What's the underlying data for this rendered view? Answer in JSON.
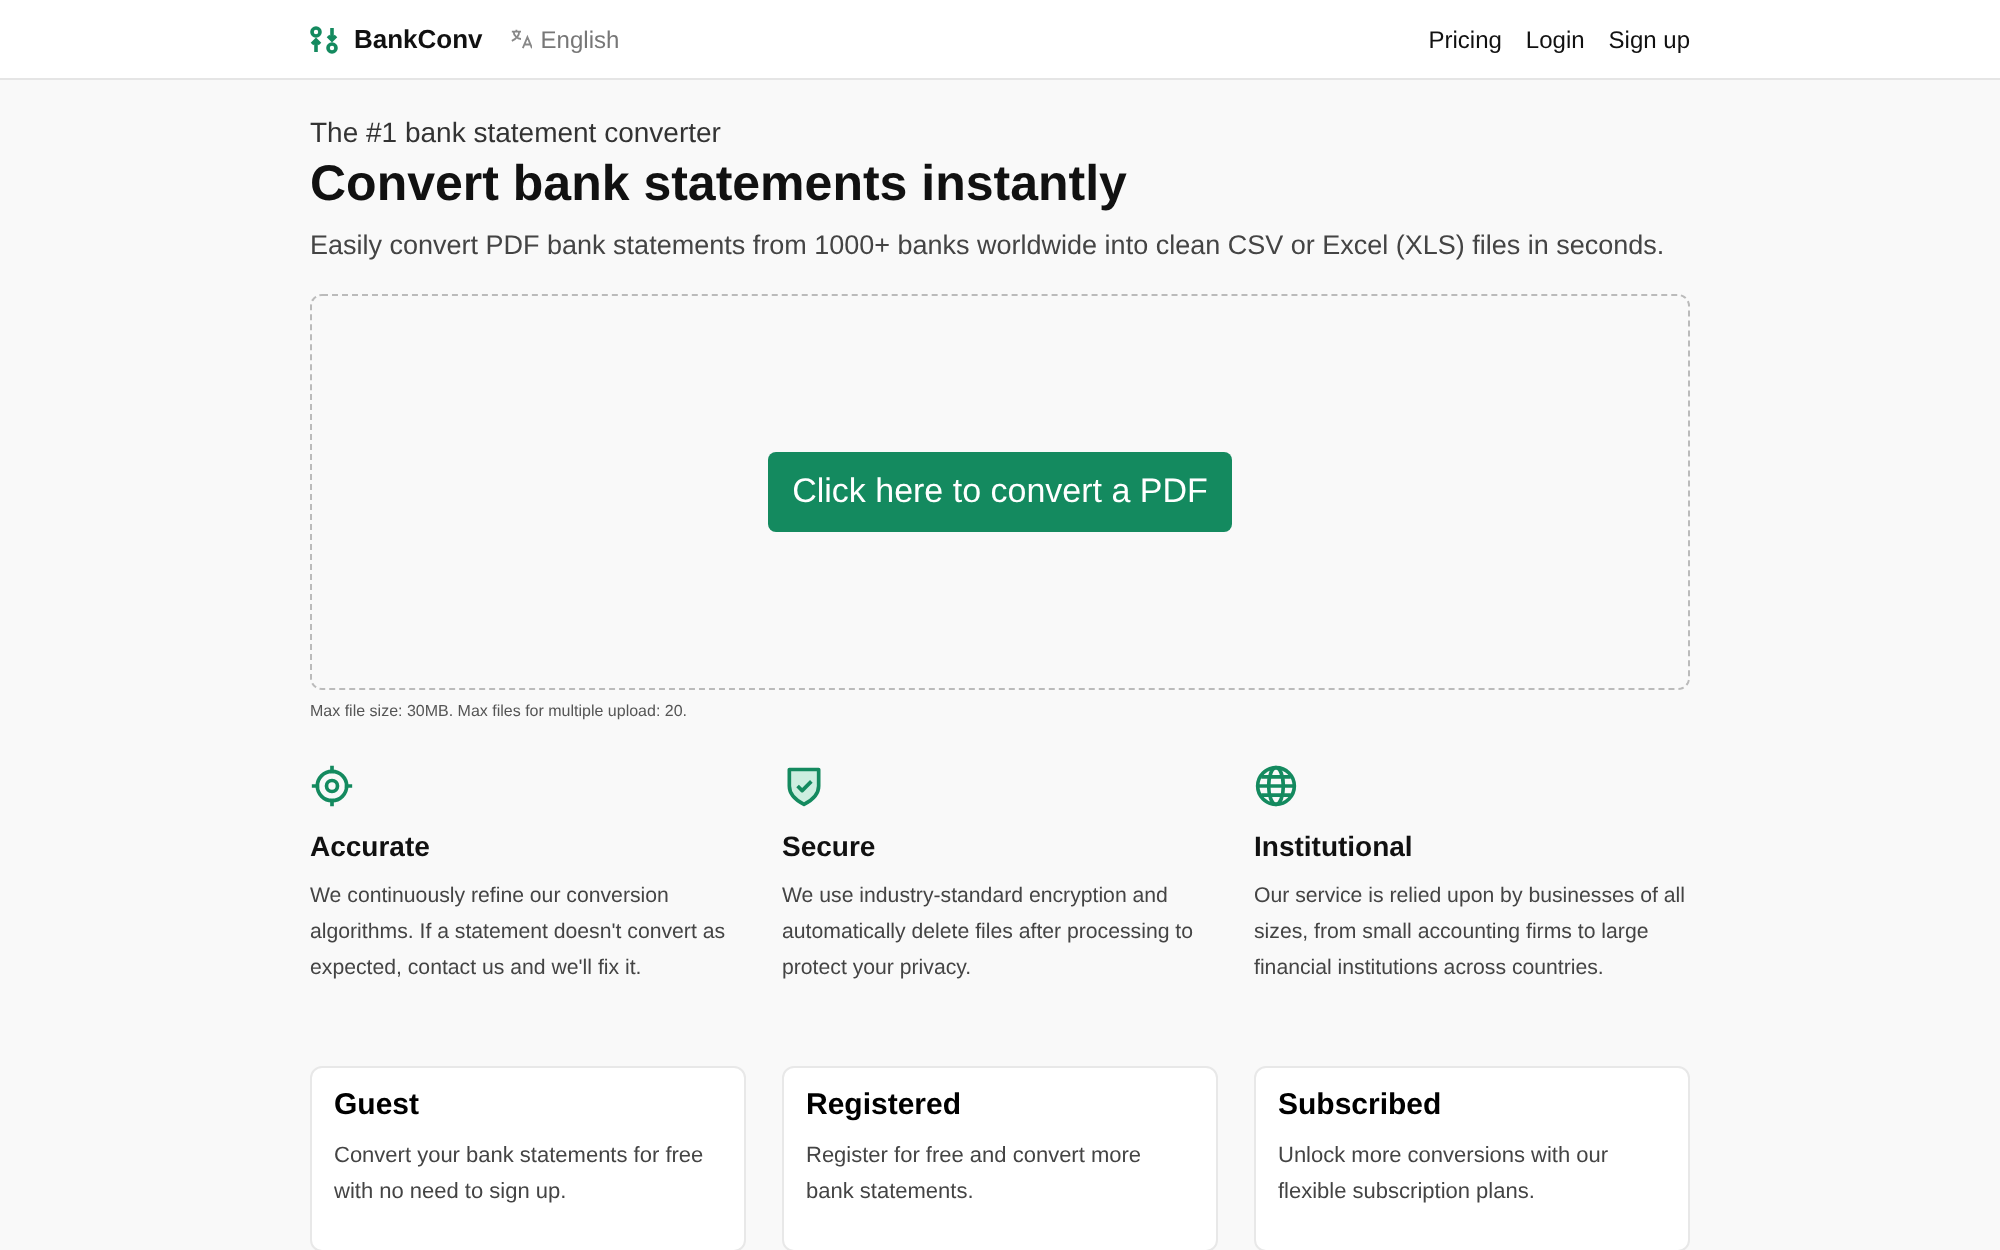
{
  "header": {
    "brand": "BankConv",
    "language": "English",
    "nav": [
      "Pricing",
      "Login",
      "Sign up"
    ]
  },
  "hero": {
    "eyebrow": "The #1 bank statement converter",
    "title": "Convert bank statements instantly",
    "subtitle": "Easily convert PDF bank statements from 1000+ banks worldwide into clean CSV or Excel (XLS) files in seconds."
  },
  "upload": {
    "button": "Click here to convert a PDF",
    "note": "Max file size: 30MB. Max files for multiple upload: 20."
  },
  "features": [
    {
      "kind": "target",
      "title": "Accurate",
      "text": "We continuously refine our conversion algorithms. If a statement doesn't convert as expected, contact us and we'll fix it."
    },
    {
      "kind": "shield",
      "title": "Secure",
      "text": "We use industry-standard encryption and automatically delete files after processing to protect your privacy."
    },
    {
      "kind": "globe",
      "title": "Institutional",
      "text": "Our service is relied upon by businesses of all sizes, from small accounting firms to large financial institutions across countries."
    }
  ],
  "plans": [
    {
      "title": "Guest",
      "text": "Convert your bank statements for free with no need to sign up."
    },
    {
      "title": "Registered",
      "text": "Register for free and convert more bank statements."
    },
    {
      "title": "Subscribed",
      "text": "Unlock more conversions with our flexible subscription plans."
    }
  ]
}
